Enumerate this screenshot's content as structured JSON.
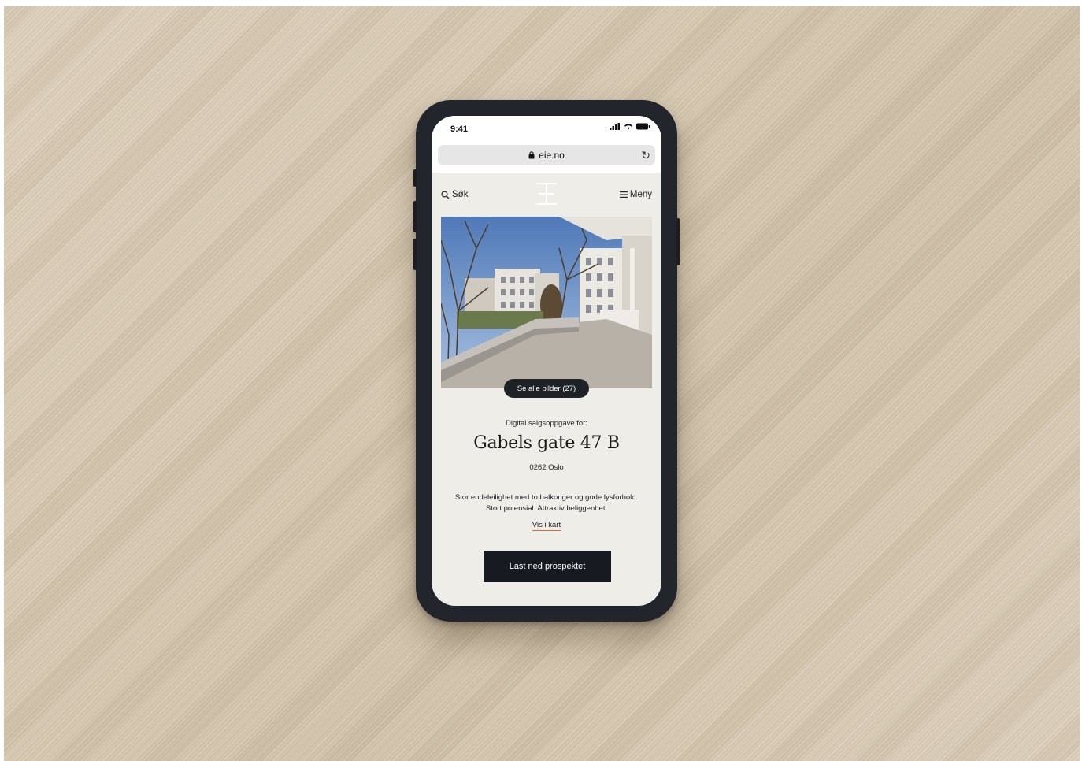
{
  "status_bar": {
    "time": "9:41"
  },
  "browser": {
    "url": "eie.no"
  },
  "nav": {
    "search_label": "Søk",
    "menu_label": "Meny"
  },
  "hero": {
    "gallery_button": "Se alle bilder (27)"
  },
  "listing": {
    "kicker": "Digital salgsoppgave for:",
    "title": "Gabels gate 47 B",
    "postal": "0262 Oslo",
    "description": "Stor endeleilighet med to balkonger og gode lysforhold. Stort potensial. Attraktiv beliggenhet.",
    "map_link": "Vis i kart",
    "cta": "Last ned prospektet"
  },
  "colors": {
    "accent_underline": "#d96b3a",
    "button_dark": "#171b21",
    "page_bg": "#efede8"
  }
}
